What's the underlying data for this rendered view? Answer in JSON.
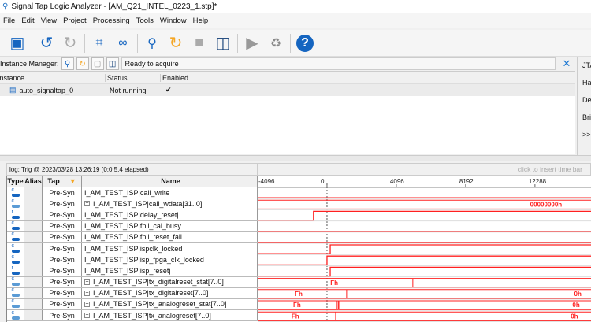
{
  "window": {
    "title": "Signal Tap Logic Analyzer - [AM_Q21_INTEL_0223_1.stp]*"
  },
  "menu": [
    "File",
    "Edit",
    "View",
    "Project",
    "Processing",
    "Tools",
    "Window",
    "Help"
  ],
  "toolbar": [
    "save-icon",
    "undo-icon",
    "redo-icon",
    "node-finder-icon",
    "binoculars-icon",
    "run-analysis-icon",
    "autorun-icon",
    "stop-icon",
    "read-data-icon",
    "play-icon",
    "recycle-icon",
    "help-icon"
  ],
  "instance_manager": {
    "label": "Instance Manager:",
    "status": "Ready to acquire",
    "columns": [
      "Instance",
      "Status",
      "Enabled"
    ],
    "rows": [
      {
        "instance": "auto_signaltap_0",
        "status": "Not running",
        "enabled": true
      }
    ]
  },
  "jtag": {
    "items": [
      "JTA",
      "Har",
      "Dev",
      "Bri",
      ">>"
    ]
  },
  "log": {
    "text": "log: Trig @ 2023/03/28 13:26:19 (0:0:5.4 elapsed)",
    "time_bar_hint": "click to insert time bar"
  },
  "grid": {
    "columns": [
      "Type",
      "Alias",
      "Tap",
      "Name"
    ],
    "axis": {
      "ticks": [
        -4096,
        0,
        4096,
        8192,
        12288
      ],
      "range": [
        -4096,
        15600
      ],
      "trigger": 0
    },
    "wave_color": "#ff2020",
    "signals": [
      {
        "type": "c",
        "tap": "Pre-Syn",
        "name": "I_AM_TEST_ISP|cali_write",
        "bus": false,
        "init": 0,
        "edges": []
      },
      {
        "type": "c",
        "tap": "Pre-Syn",
        "name": "I_AM_TEST_ISP|cali_wdata[31..0]",
        "bus": true,
        "edges": [],
        "labels": [
          {
            "t": 12000,
            "text": "00000000h"
          }
        ]
      },
      {
        "type": "r",
        "tap": "Pre-Syn",
        "name": "I_AM_TEST_ISP|delay_resetj",
        "bus": false,
        "init": 0,
        "edges": [
          -800
        ]
      },
      {
        "type": "c",
        "tap": "Pre-Syn",
        "name": "I_AM_TEST_ISP|fpll_cal_busy",
        "bus": false,
        "init": 0,
        "edges": []
      },
      {
        "type": "c",
        "tap": "Pre-Syn",
        "name": "I_AM_TEST_ISP|fpll_reset_fall",
        "bus": false,
        "init": 0,
        "edges": []
      },
      {
        "type": "c",
        "tap": "Pre-Syn",
        "name": "I_AM_TEST_ISP|ispclk_locked",
        "bus": false,
        "init": 0,
        "edges": [
          190
        ]
      },
      {
        "type": "c",
        "tap": "Pre-Syn",
        "name": "I_AM_TEST_ISP|isp_fpga_clk_locked",
        "bus": false,
        "init": 0,
        "edges": [
          0
        ]
      },
      {
        "type": "r",
        "tap": "Pre-Syn",
        "name": "I_AM_TEST_ISP|isp_resetj",
        "bus": false,
        "init": 0,
        "edges": [
          190
        ]
      },
      {
        "type": "c",
        "tap": "Pre-Syn",
        "name": "I_AM_TEST_ISP|tx_digitalreset_stat[7..0]",
        "bus": true,
        "edges": [
          5070
        ],
        "labels": [
          {
            "t": 200,
            "text": "Fh"
          }
        ]
      },
      {
        "type": "c",
        "tap": "Pre-Syn",
        "name": "I_AM_TEST_ISP|tx_digitalreset[7..0]",
        "bus": true,
        "edges": [
          1160
        ],
        "labels": [
          {
            "t": -1900,
            "text": "Fh"
          },
          {
            "t": 14600,
            "text": "0h"
          }
        ]
      },
      {
        "type": "c",
        "tap": "Pre-Syn",
        "name": "I_AM_TEST_ISP|tx_analogreset_stat[7..0]",
        "bus": true,
        "edges": [
          600,
          680,
          750
        ],
        "labels": [
          {
            "t": -2000,
            "text": "Fh"
          },
          {
            "t": 14500,
            "text": "0h"
          }
        ]
      },
      {
        "type": "c",
        "tap": "Pre-Syn",
        "name": "I_AM_TEST_ISP|tx_analogreset[7..0]",
        "bus": true,
        "edges": [
          510
        ],
        "labels": [
          {
            "t": -2100,
            "text": "Fh"
          },
          {
            "t": 14400,
            "text": "0h"
          }
        ]
      }
    ]
  }
}
